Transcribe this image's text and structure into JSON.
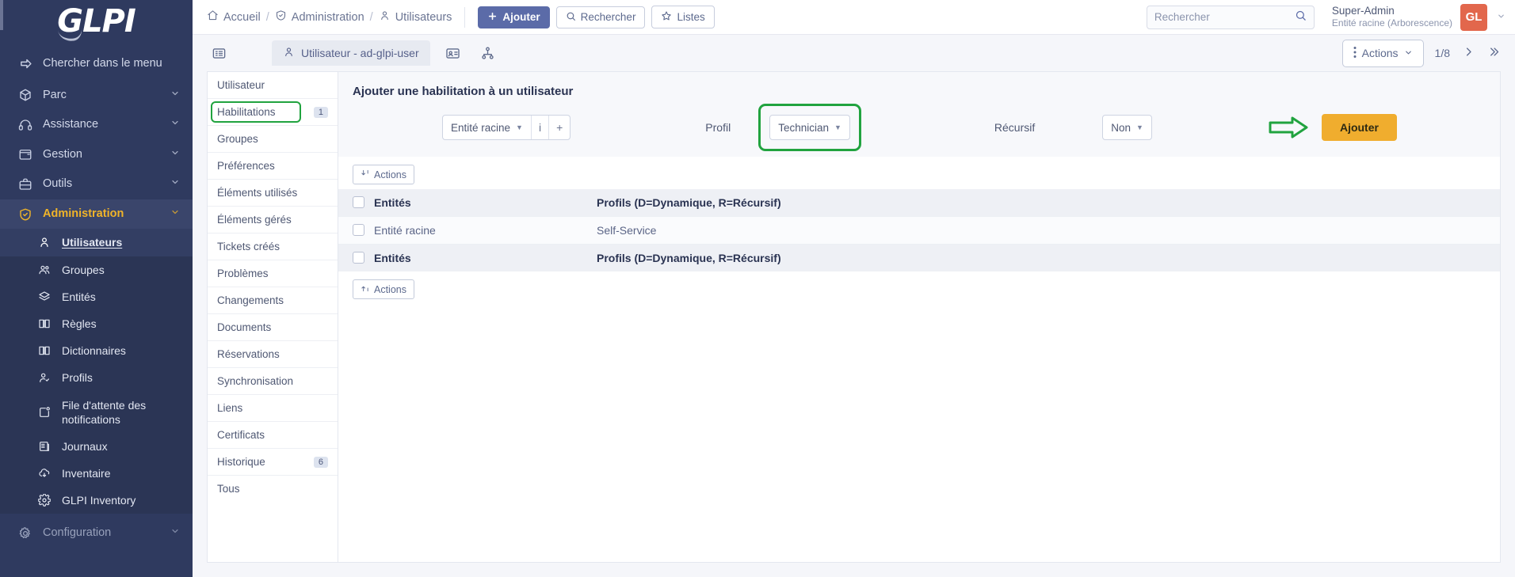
{
  "brand": {
    "logo_text": "GLPI",
    "accent": "#f0b429",
    "sidebar_bg": "#2f3a5f"
  },
  "sidebar": {
    "search_label": "Chercher dans le menu",
    "items": [
      {
        "label": "Parc",
        "icon": "box-icon"
      },
      {
        "label": "Assistance",
        "icon": "headset-icon"
      },
      {
        "label": "Gestion",
        "icon": "wallet-icon"
      },
      {
        "label": "Outils",
        "icon": "briefcase-icon"
      },
      {
        "label": "Administration",
        "icon": "shield-icon"
      }
    ],
    "admin_subitems": [
      {
        "label": "Utilisateurs",
        "icon": "user-icon"
      },
      {
        "label": "Groupes",
        "icon": "users-icon"
      },
      {
        "label": "Entités",
        "icon": "layers-icon"
      },
      {
        "label": "Règles",
        "icon": "book-icon"
      },
      {
        "label": "Dictionnaires",
        "icon": "book-icon"
      },
      {
        "label": "Profils",
        "icon": "user-check-icon"
      },
      {
        "label": "File d'attente des notifications",
        "icon": "notification-icon"
      },
      {
        "label": "Journaux",
        "icon": "journal-icon"
      },
      {
        "label": "Inventaire",
        "icon": "cloud-download-icon"
      },
      {
        "label": "GLPI Inventory",
        "icon": "gear-icon"
      }
    ],
    "config_label": "Configuration"
  },
  "topbar": {
    "breadcrumb": [
      {
        "label": "Accueil",
        "icon": "home-icon"
      },
      {
        "label": "Administration",
        "icon": "shield-icon"
      },
      {
        "label": "Utilisateurs",
        "icon": "user-icon"
      }
    ],
    "add_label": "Ajouter",
    "search_label": "Rechercher",
    "lists_label": "Listes",
    "global_search_placeholder": "Rechercher",
    "global_search_value": "",
    "user_name": "Super-Admin",
    "user_entity": "Entité racine (Arborescence)",
    "avatar_initials": "GL",
    "avatar_color": "#e2674c"
  },
  "tabbar": {
    "tab_label": "Utilisateur - ad-glpi-user",
    "actions_label": "Actions",
    "page_indicator": "1/8"
  },
  "left_tabs": [
    {
      "label": "Utilisateur",
      "badge": ""
    },
    {
      "label": "Habilitations",
      "badge": "1",
      "highlighted": true
    },
    {
      "label": "Groupes",
      "badge": ""
    },
    {
      "label": "Préférences",
      "badge": ""
    },
    {
      "label": "Éléments utilisés",
      "badge": ""
    },
    {
      "label": "Éléments gérés",
      "badge": ""
    },
    {
      "label": "Tickets créés",
      "badge": ""
    },
    {
      "label": "Problèmes",
      "badge": ""
    },
    {
      "label": "Changements",
      "badge": ""
    },
    {
      "label": "Documents",
      "badge": ""
    },
    {
      "label": "Réservations",
      "badge": ""
    },
    {
      "label": "Synchronisation",
      "badge": ""
    },
    {
      "label": "Liens",
      "badge": ""
    },
    {
      "label": "Certificats",
      "badge": ""
    },
    {
      "label": "Historique",
      "badge": "6"
    },
    {
      "label": "Tous",
      "badge": ""
    }
  ],
  "panel": {
    "title": "Ajouter une habilitation à un utilisateur",
    "entity_value": "Entité racine",
    "entity_info_icon": "info-icon",
    "entity_add_icon": "plus-icon",
    "profil_label": "Profil",
    "profil_value": "Technician",
    "recursif_label": "Récursif",
    "recursif_value": "Non",
    "submit_label": "Ajouter",
    "actions_top_label": "Actions",
    "actions_bottom_label": "Actions",
    "table": {
      "headers": [
        "Entités",
        "Profils (D=Dynamique, R=Récursif)"
      ],
      "rows": [
        {
          "entity": "Entité racine",
          "profile": "Self-Service"
        }
      ],
      "footer_headers": [
        "Entités",
        "Profils (D=Dynamique, R=Récursif)"
      ]
    }
  }
}
